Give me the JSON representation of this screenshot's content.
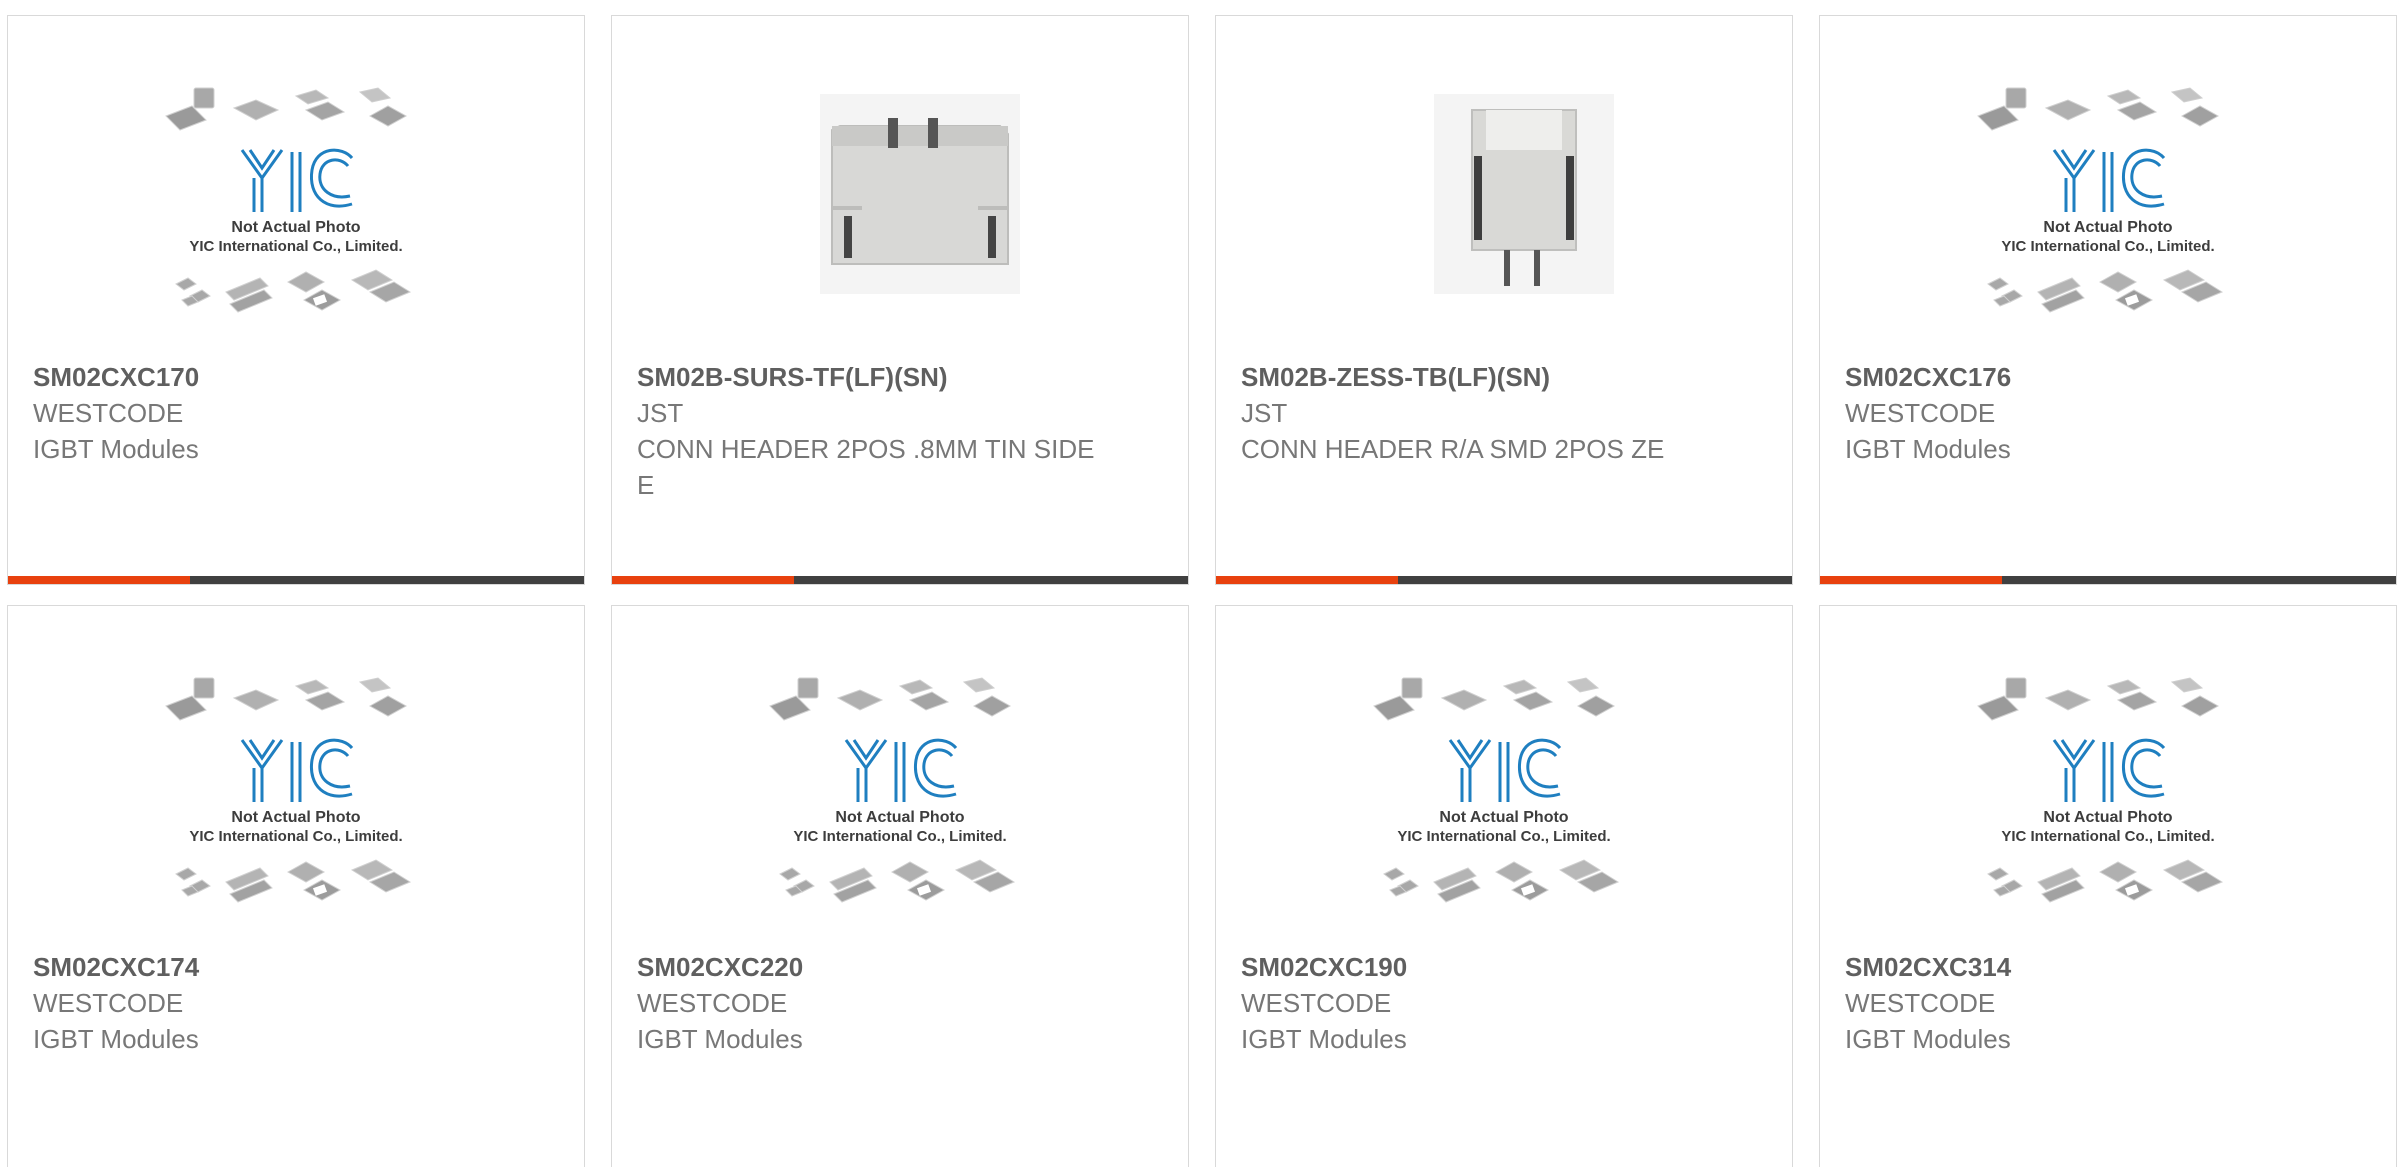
{
  "colors": {
    "accent": "#e8410e",
    "bar": "#404040",
    "logo_blue": "#1f7fc0",
    "title_text": "#5f5f5f",
    "body_text": "#777777"
  },
  "placeholder": {
    "line1": "Not Actual Photo",
    "line2": "YIC International Co., Limited.",
    "logo_text": "YIC"
  },
  "products": [
    {
      "part": "SM02CXC170",
      "manufacturer": "WESTCODE",
      "description": "IGBT Modules",
      "image": "yic-placeholder"
    },
    {
      "part": "SM02B-SURS-TF(LF)(SN)",
      "manufacturer": "JST",
      "description": "CONN HEADER 2POS .8MM TIN SIDE E",
      "image": "connector-photo-a"
    },
    {
      "part": "SM02B-ZESS-TB(LF)(SN)",
      "manufacturer": "JST",
      "description": "CONN HEADER R/A SMD 2POS ZE",
      "image": "connector-photo-b"
    },
    {
      "part": "SM02CXC176",
      "manufacturer": "WESTCODE",
      "description": "IGBT Modules",
      "image": "yic-placeholder"
    },
    {
      "part": "SM02CXC174",
      "manufacturer": "WESTCODE",
      "description": "IGBT Modules",
      "image": "yic-placeholder"
    },
    {
      "part": "SM02CXC220",
      "manufacturer": "WESTCODE",
      "description": "IGBT Modules",
      "image": "yic-placeholder"
    },
    {
      "part": "SM02CXC190",
      "manufacturer": "WESTCODE",
      "description": "IGBT Modules",
      "image": "yic-placeholder"
    },
    {
      "part": "SM02CXC314",
      "manufacturer": "WESTCODE",
      "description": "IGBT Modules",
      "image": "yic-placeholder"
    }
  ]
}
